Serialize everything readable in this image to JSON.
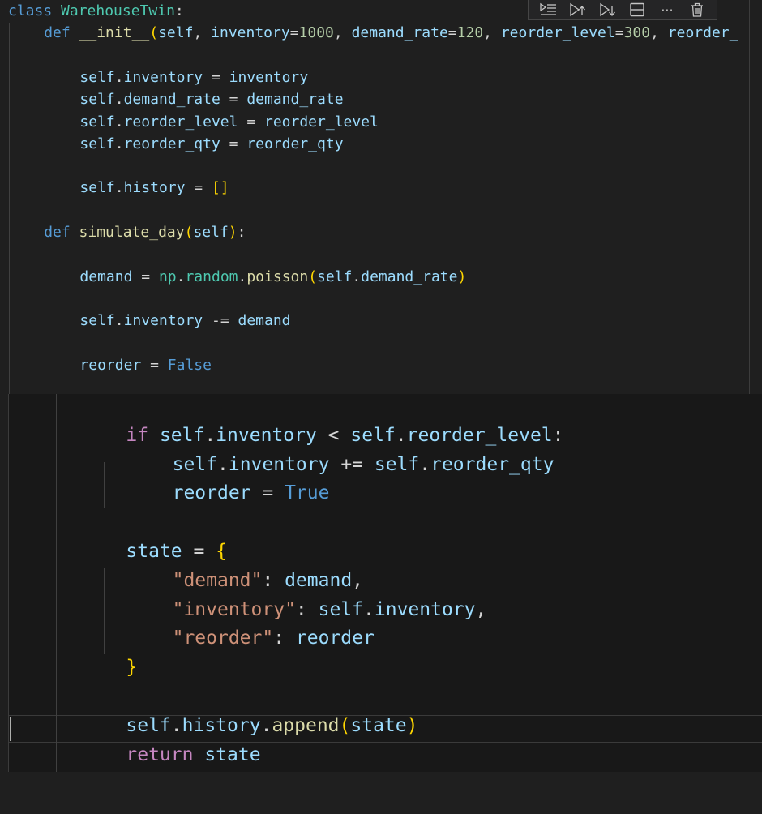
{
  "colors": {
    "background": "#1f1f1f",
    "keyword": "#569cd6",
    "control_keyword": "#c586c0",
    "class_name": "#4ec9b0",
    "function_name": "#dcdcaa",
    "variable": "#9cdcfe",
    "number": "#b5cea8",
    "string": "#ce9178",
    "bracket_gold": "#ffd700",
    "bracket_purple": "#da70d6"
  },
  "toolbar": {
    "icons": [
      "run-by-line-icon",
      "execute-above-icon",
      "execute-below-icon",
      "split-cell-icon",
      "more-actions-icon",
      "delete-cell-icon"
    ],
    "more_label": "···"
  },
  "top_cell": {
    "lines": [
      {
        "indent": 0,
        "tokens": [
          {
            "text": "class",
            "type": "kw"
          },
          {
            "text": " ",
            "type": "op"
          },
          {
            "text": "WarehouseTwin",
            "type": "cls"
          },
          {
            "text": ":",
            "type": "op"
          }
        ]
      },
      {
        "indent": 4,
        "tokens": [
          {
            "text": "def",
            "type": "kw"
          },
          {
            "text": " ",
            "type": "op"
          },
          {
            "text": "__init__",
            "type": "fn"
          },
          {
            "text": "(",
            "type": "p1"
          },
          {
            "text": "self",
            "type": "var"
          },
          {
            "text": ", ",
            "type": "op"
          },
          {
            "text": "inventory",
            "type": "var"
          },
          {
            "text": "=",
            "type": "op"
          },
          {
            "text": "1000",
            "type": "num"
          },
          {
            "text": ", ",
            "type": "op"
          },
          {
            "text": "demand_rate",
            "type": "var"
          },
          {
            "text": "=",
            "type": "op"
          },
          {
            "text": "120",
            "type": "num"
          },
          {
            "text": ", ",
            "type": "op"
          },
          {
            "text": "reorder_level",
            "type": "var"
          },
          {
            "text": "=",
            "type": "op"
          },
          {
            "text": "300",
            "type": "num"
          },
          {
            "text": ", ",
            "type": "op"
          },
          {
            "text": "reorder_",
            "type": "var"
          }
        ]
      },
      {
        "indent": 0,
        "tokens": []
      },
      {
        "indent": 8,
        "tokens": [
          {
            "text": "self",
            "type": "var"
          },
          {
            "text": ".",
            "type": "op"
          },
          {
            "text": "inventory",
            "type": "var"
          },
          {
            "text": " = ",
            "type": "op"
          },
          {
            "text": "inventory",
            "type": "var"
          }
        ]
      },
      {
        "indent": 8,
        "tokens": [
          {
            "text": "self",
            "type": "var"
          },
          {
            "text": ".",
            "type": "op"
          },
          {
            "text": "demand_rate",
            "type": "var"
          },
          {
            "text": " = ",
            "type": "op"
          },
          {
            "text": "demand_rate",
            "type": "var"
          }
        ]
      },
      {
        "indent": 8,
        "tokens": [
          {
            "text": "self",
            "type": "var"
          },
          {
            "text": ".",
            "type": "op"
          },
          {
            "text": "reorder_level",
            "type": "var"
          },
          {
            "text": " = ",
            "type": "op"
          },
          {
            "text": "reorder_level",
            "type": "var"
          }
        ]
      },
      {
        "indent": 8,
        "tokens": [
          {
            "text": "self",
            "type": "var"
          },
          {
            "text": ".",
            "type": "op"
          },
          {
            "text": "reorder_qty",
            "type": "var"
          },
          {
            "text": " = ",
            "type": "op"
          },
          {
            "text": "reorder_qty",
            "type": "var"
          }
        ]
      },
      {
        "indent": 0,
        "tokens": []
      },
      {
        "indent": 8,
        "tokens": [
          {
            "text": "self",
            "type": "var"
          },
          {
            "text": ".",
            "type": "op"
          },
          {
            "text": "history",
            "type": "var"
          },
          {
            "text": " = ",
            "type": "op"
          },
          {
            "text": "[]",
            "type": "p1"
          }
        ]
      },
      {
        "indent": 0,
        "tokens": []
      },
      {
        "indent": 4,
        "tokens": [
          {
            "text": "def",
            "type": "kw"
          },
          {
            "text": " ",
            "type": "op"
          },
          {
            "text": "simulate_day",
            "type": "fn"
          },
          {
            "text": "(",
            "type": "p1"
          },
          {
            "text": "self",
            "type": "var"
          },
          {
            "text": ")",
            "type": "p1"
          },
          {
            "text": ":",
            "type": "op"
          }
        ]
      },
      {
        "indent": 0,
        "tokens": []
      },
      {
        "indent": 8,
        "tokens": [
          {
            "text": "demand",
            "type": "var"
          },
          {
            "text": " = ",
            "type": "op"
          },
          {
            "text": "np",
            "type": "cls"
          },
          {
            "text": ".",
            "type": "op"
          },
          {
            "text": "random",
            "type": "cls"
          },
          {
            "text": ".",
            "type": "op"
          },
          {
            "text": "poisson",
            "type": "fn"
          },
          {
            "text": "(",
            "type": "p1"
          },
          {
            "text": "self",
            "type": "var"
          },
          {
            "text": ".",
            "type": "op"
          },
          {
            "text": "demand_rate",
            "type": "var"
          },
          {
            "text": ")",
            "type": "p1"
          }
        ]
      },
      {
        "indent": 0,
        "tokens": []
      },
      {
        "indent": 8,
        "tokens": [
          {
            "text": "self",
            "type": "var"
          },
          {
            "text": ".",
            "type": "op"
          },
          {
            "text": "inventory",
            "type": "var"
          },
          {
            "text": " -= ",
            "type": "op"
          },
          {
            "text": "demand",
            "type": "var"
          }
        ]
      },
      {
        "indent": 0,
        "tokens": []
      },
      {
        "indent": 8,
        "tokens": [
          {
            "text": "reorder",
            "type": "var"
          },
          {
            "text": " = ",
            "type": "op"
          },
          {
            "text": "False",
            "type": "kw"
          }
        ]
      }
    ]
  },
  "bottom_cell": {
    "lines": [
      {
        "indent": 0,
        "tokens": []
      },
      {
        "indent": 8,
        "tokens": [
          {
            "text": "if",
            "type": "ctrl"
          },
          {
            "text": " ",
            "type": "op"
          },
          {
            "text": "self",
            "type": "var"
          },
          {
            "text": ".",
            "type": "op"
          },
          {
            "text": "inventory",
            "type": "var"
          },
          {
            "text": " < ",
            "type": "op"
          },
          {
            "text": "self",
            "type": "var"
          },
          {
            "text": ".",
            "type": "op"
          },
          {
            "text": "reorder_level",
            "type": "var"
          },
          {
            "text": ":",
            "type": "op"
          }
        ]
      },
      {
        "indent": 12,
        "tokens": [
          {
            "text": "self",
            "type": "var"
          },
          {
            "text": ".",
            "type": "op"
          },
          {
            "text": "inventory",
            "type": "var"
          },
          {
            "text": " += ",
            "type": "op"
          },
          {
            "text": "self",
            "type": "var"
          },
          {
            "text": ".",
            "type": "op"
          },
          {
            "text": "reorder_qty",
            "type": "var"
          }
        ]
      },
      {
        "indent": 12,
        "tokens": [
          {
            "text": "reorder",
            "type": "var"
          },
          {
            "text": " = ",
            "type": "op"
          },
          {
            "text": "True",
            "type": "kw"
          }
        ]
      },
      {
        "indent": 0,
        "tokens": []
      },
      {
        "indent": 8,
        "tokens": [
          {
            "text": "state",
            "type": "var"
          },
          {
            "text": " = ",
            "type": "op"
          },
          {
            "text": "{",
            "type": "p1"
          }
        ]
      },
      {
        "indent": 12,
        "tokens": [
          {
            "text": "\"demand\"",
            "type": "str"
          },
          {
            "text": ": ",
            "type": "op"
          },
          {
            "text": "demand",
            "type": "var"
          },
          {
            "text": ",",
            "type": "op"
          }
        ]
      },
      {
        "indent": 12,
        "tokens": [
          {
            "text": "\"inventory\"",
            "type": "str"
          },
          {
            "text": ": ",
            "type": "op"
          },
          {
            "text": "self",
            "type": "var"
          },
          {
            "text": ".",
            "type": "op"
          },
          {
            "text": "inventory",
            "type": "var"
          },
          {
            "text": ",",
            "type": "op"
          }
        ]
      },
      {
        "indent": 12,
        "tokens": [
          {
            "text": "\"reorder\"",
            "type": "str"
          },
          {
            "text": ": ",
            "type": "op"
          },
          {
            "text": "reorder",
            "type": "var"
          }
        ]
      },
      {
        "indent": 8,
        "tokens": [
          {
            "text": "}",
            "type": "p1"
          }
        ]
      },
      {
        "indent": 0,
        "tokens": []
      },
      {
        "indent": 8,
        "tokens": [
          {
            "text": "self",
            "type": "var"
          },
          {
            "text": ".",
            "type": "op"
          },
          {
            "text": "history",
            "type": "var"
          },
          {
            "text": ".",
            "type": "op"
          },
          {
            "text": "append",
            "type": "fn"
          },
          {
            "text": "(",
            "type": "p1"
          },
          {
            "text": "state",
            "type": "var"
          },
          {
            "text": ")",
            "type": "p1"
          }
        ]
      },
      {
        "indent": 8,
        "tokens": [
          {
            "text": "return",
            "type": "ctrl"
          },
          {
            "text": " ",
            "type": "op"
          },
          {
            "text": "state",
            "type": "var"
          }
        ]
      }
    ]
  }
}
